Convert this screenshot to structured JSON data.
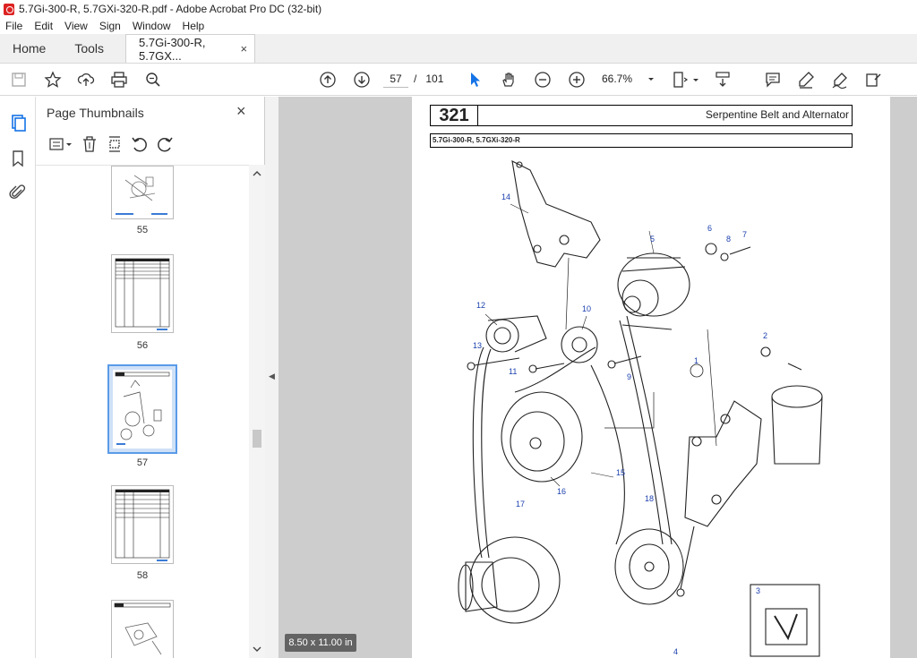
{
  "window": {
    "title": "5.7Gi-300-R, 5.7GXi-320-R.pdf - Adobe Acrobat Pro DC (32-bit)"
  },
  "menu": [
    "File",
    "Edit",
    "View",
    "Sign",
    "Window",
    "Help"
  ],
  "tabs": {
    "home": "Home",
    "tools": "Tools",
    "doc": "5.7Gi-300-R, 5.7GX...",
    "doc_close": "×"
  },
  "toolbar": {
    "current_page": "57",
    "page_sep": "/",
    "total_pages": "101",
    "zoom": "66.7%"
  },
  "panel": {
    "title": "Page Thumbnails",
    "close": "×",
    "thumbnails": [
      {
        "label": "55"
      },
      {
        "label": "56"
      },
      {
        "label": "57",
        "selected": true
      },
      {
        "label": "58"
      },
      {
        "label": ""
      }
    ]
  },
  "document": {
    "page_number": "321",
    "title": "Serpentine Belt and Alternator",
    "models": "5.7Gi-300-R, 5.7GXi-320-R",
    "callouts": [
      "14",
      "5",
      "6",
      "8",
      "7",
      "12",
      "10",
      "13",
      "11",
      "9",
      "2",
      "1",
      "15",
      "16",
      "17",
      "18",
      "3",
      "4"
    ],
    "page_size": "8.50 x 11.00 in"
  },
  "colors": {
    "accent": "#1473e6",
    "callout": "#1a3fae",
    "doc_bg": "#cdcdcd"
  }
}
